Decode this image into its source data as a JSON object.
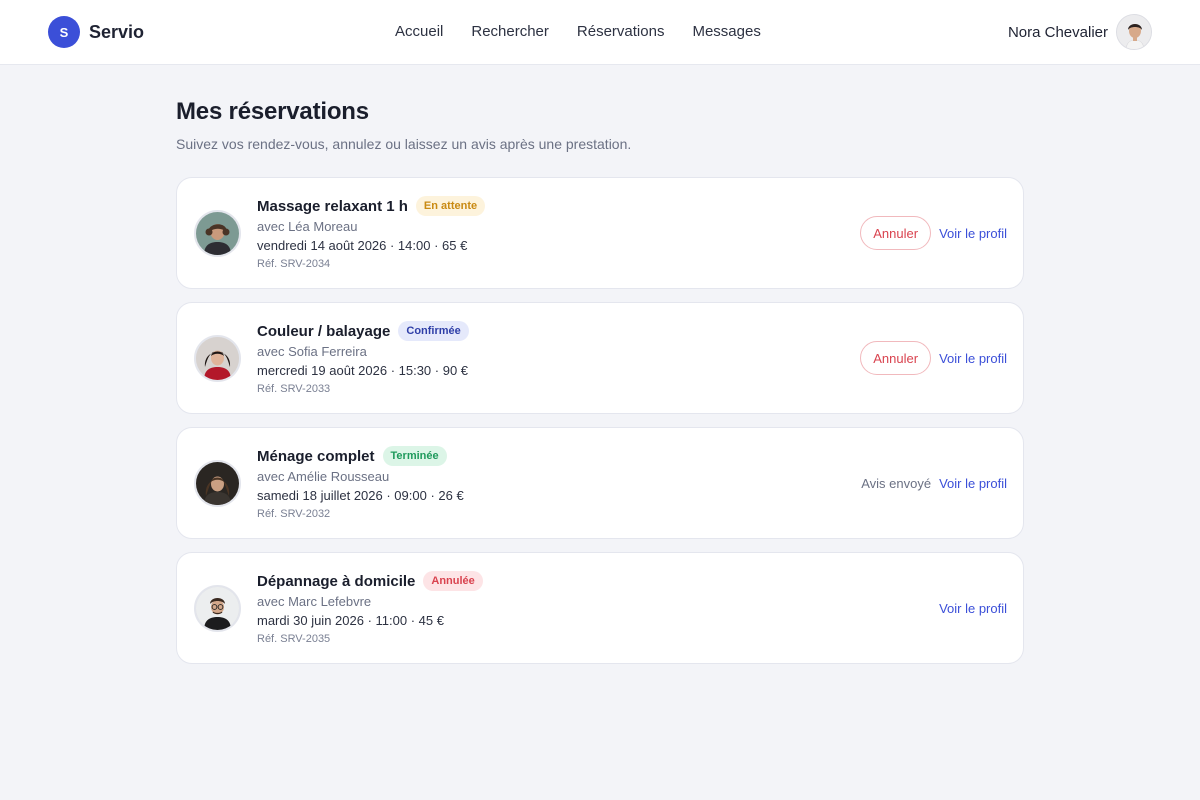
{
  "app": {
    "name": "Servio",
    "logo_letter": "S",
    "accent": "#3b4fd8"
  },
  "nav": {
    "items": [
      {
        "label": "Accueil"
      },
      {
        "label": "Rechercher"
      },
      {
        "label": "Réservations"
      },
      {
        "label": "Messages"
      }
    ]
  },
  "user": {
    "name": "Nora Chevalier"
  },
  "page": {
    "title": "Mes réservations",
    "subtitle": "Suivez vos rendez-vous, annulez ou laissez un avis après une prestation."
  },
  "bookings": [
    {
      "service": "Massage relaxant 1 h",
      "status": "En attente",
      "status_color": "#c98a12",
      "status_bg": "#fdf3dc",
      "provider": "avec Léa Moreau",
      "when": "vendredi 14 août 2026 · 14:00 · 65 €",
      "ref": "Réf. SRV-2034",
      "cancel_label": "Annuler",
      "profile_label": "Voir le profil",
      "avatar_icon": "person-photo-woman-curly"
    },
    {
      "service": "Couleur / balayage",
      "status": "Confirmée",
      "status_color": "#2f3fa8",
      "status_bg": "#e5e9fb",
      "provider": "avec Sofia Ferreira",
      "when": "mercredi 19 août 2026 · 15:30 · 90 €",
      "ref": "Réf. SRV-2033",
      "cancel_label": "Annuler",
      "profile_label": "Voir le profil",
      "avatar_icon": "person-photo-woman-dark-hair"
    },
    {
      "service": "Ménage complet",
      "status": "Terminée",
      "status_color": "#1f9a5c",
      "status_bg": "#dcf5e7",
      "provider": "avec Amélie Rousseau",
      "when": "samedi 18 juillet 2026 · 09:00 · 26 €",
      "ref": "Réf. SRV-2032",
      "sent_label": "Avis envoyé",
      "profile_label": "Voir le profil",
      "avatar_icon": "person-photo-woman-long-hair"
    },
    {
      "service": "Dépannage à domicile",
      "status": "Annulée",
      "status_color": "#d9434f",
      "status_bg": "#fde4e6",
      "provider": "avec Marc Lefebvre",
      "when": "mardi 30 juin 2026 · 11:00 · 45 €",
      "ref": "Réf. SRV-2035",
      "profile_label": "Voir le profil",
      "avatar_icon": "person-photo-man-glasses"
    }
  ]
}
